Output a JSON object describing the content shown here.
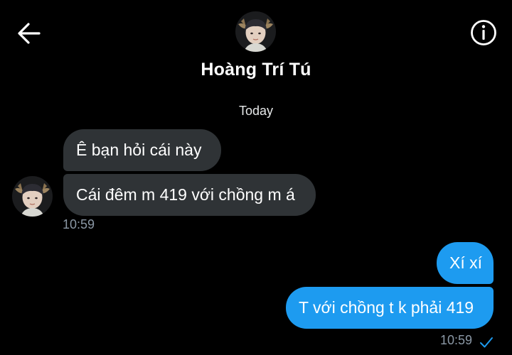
{
  "header": {
    "contact_name": "Hoàng Trí Tú",
    "back_icon": "arrow-left-icon",
    "info_icon": "info-circle-icon"
  },
  "conversation": {
    "day_separator": "Today",
    "incoming": [
      {
        "text": "Ê bạn hỏi cái này"
      },
      {
        "text": "Cái đêm m 419 với chồng m á"
      }
    ],
    "incoming_time": "10:59",
    "outgoing": [
      {
        "text": "Xí xí"
      },
      {
        "text": "T với chồng t k phải 419"
      }
    ],
    "outgoing_time": "10:59",
    "read_status_icon": "check-icon"
  },
  "colors": {
    "background": "#000000",
    "incoming_bubble": "#2f3336",
    "outgoing_bubble": "#1d9bf0",
    "meta_text": "#8b98a5"
  }
}
